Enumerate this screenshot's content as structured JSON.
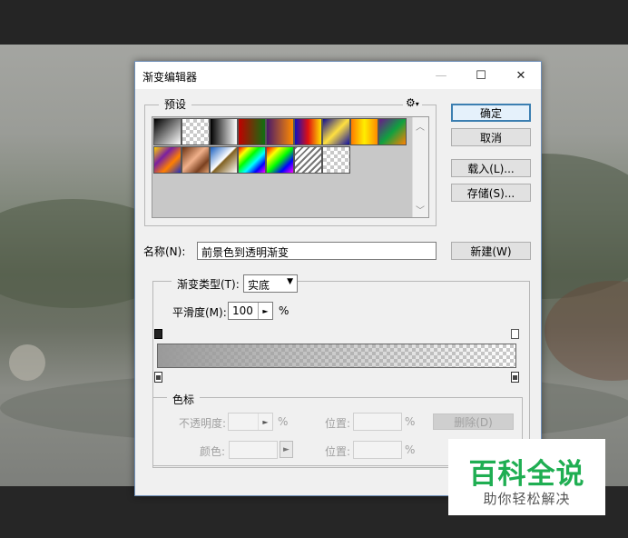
{
  "dialog": {
    "title": "渐变编辑器",
    "minimize_glyph": "—",
    "maximize_glyph": "☐",
    "close_glyph": "✕"
  },
  "presets": {
    "label": "预设",
    "gear_icon": "gear-icon",
    "gear_glyph": "⚙",
    "swatches": [
      {
        "name": "foreground-to-background",
        "css": "linear-gradient(135deg, #000 0%, #fff 100%)"
      },
      {
        "name": "foreground-to-transparent",
        "css": "checker"
      },
      {
        "name": "black-white",
        "css": "linear-gradient(90deg, #000 0%, #fff 100%)"
      },
      {
        "name": "red-green",
        "css": "linear-gradient(90deg, #c00000 0%, #107010 100%)"
      },
      {
        "name": "violet-orange",
        "css": "linear-gradient(90deg, #4a1a6a 0%, #ff8a00 100%)"
      },
      {
        "name": "blue-red-yellow",
        "css": "linear-gradient(90deg, #1010c0 0%, #e01010 50%, #ffe000 100%)"
      },
      {
        "name": "blue-yellow-blue",
        "css": "linear-gradient(135deg, #101090 0%, #ffe040 50%, #1010a0 100%)"
      },
      {
        "name": "orange-yellow-orange",
        "css": "linear-gradient(90deg, #ff7a00 0%, #ffee00 50%, #ff8a00 100%)"
      },
      {
        "name": "violet-green-orange",
        "css": "linear-gradient(135deg, #6a1a8a 0%, #10a040 50%, #ff8000 100%)"
      },
      {
        "name": "yellow-violet-orange-blue",
        "css": "linear-gradient(135deg, #ffd000 0%, #7a20a0 35%, #ff8000 65%, #2030c0 100%)"
      },
      {
        "name": "copper",
        "css": "linear-gradient(135deg, #6a3010 0%, #f0b08a 45%, #7a4020 75%, #e0a070 100%)"
      },
      {
        "name": "chrome",
        "css": "linear-gradient(135deg, #1a60c0 0%, #ffffff 48%, #806020 52%, #ffffff 100%)"
      },
      {
        "name": "spectrum",
        "css": "linear-gradient(135deg, #ff0000 0%, #ffff00 20%, #00ff00 40%, #00ffff 60%, #0000ff 80%, #ff00ff 100%)"
      },
      {
        "name": "transparent-rainbow",
        "css": "linear-gradient(135deg, #ff0000 0%, #ffff00 25%, #00ff00 50%, #0000ff 75%, #ff00ff 100%)"
      },
      {
        "name": "transparent-stripes",
        "css": "repeating-linear-gradient(135deg, #777 0px, #777 2px, #fff 2px, #fff 5px)"
      },
      {
        "name": "neutral-density",
        "css": "checker"
      }
    ]
  },
  "buttons": {
    "ok": "确定",
    "cancel": "取消",
    "load": "载入(L)...",
    "save": "存储(S)...",
    "new": "新建(W)",
    "delete": "删除(D)"
  },
  "name_row": {
    "label": "名称(N):",
    "value": "前景色到透明渐变"
  },
  "gradient": {
    "type_label": "渐变类型(T):",
    "type_value": "实底",
    "smoothness_label": "平滑度(M):",
    "smoothness_value": "100",
    "percent": "%",
    "stops_label": "色标",
    "opacity_label": "不透明度:",
    "color_label": "颜色:",
    "location_label": "位置:",
    "start_color": "#9a9a9a"
  },
  "watermark": {
    "title": "百科全说",
    "subtitle": "助你轻松解决"
  }
}
